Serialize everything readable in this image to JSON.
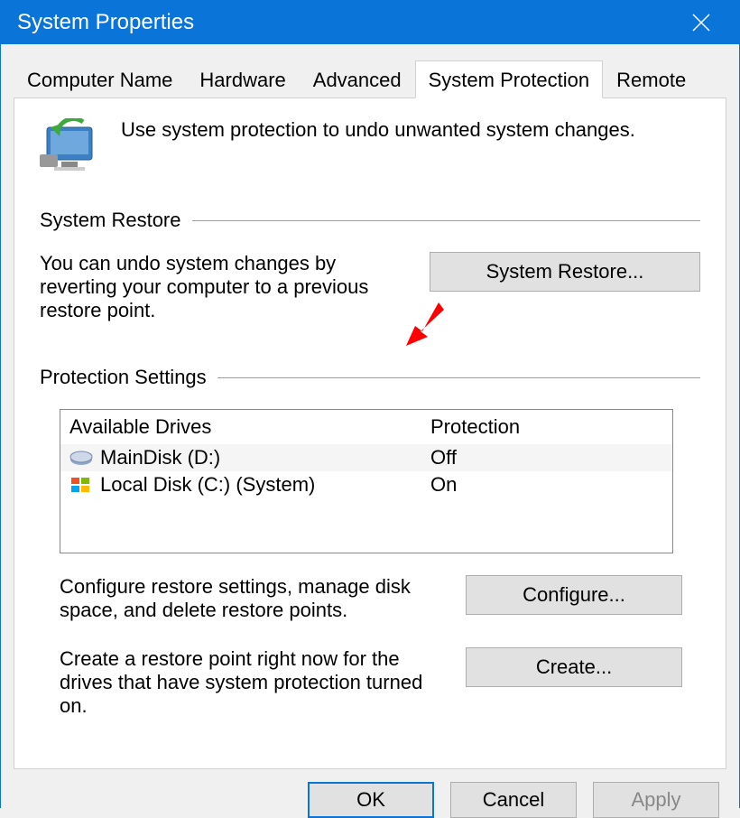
{
  "window": {
    "title": "System Properties"
  },
  "tabs": {
    "computer_name": "Computer Name",
    "hardware": "Hardware",
    "advanced": "Advanced",
    "system_protection": "System Protection",
    "remote": "Remote"
  },
  "header_text": "Use system protection to undo unwanted system changes.",
  "restore_section": {
    "title": "System Restore",
    "desc": "You can undo system changes by reverting your computer to a previous restore point.",
    "button": "System Restore..."
  },
  "protection_section": {
    "title": "Protection Settings",
    "columns": {
      "drives": "Available Drives",
      "protection": "Protection"
    },
    "rows": [
      {
        "name": "MainDisk (D:)",
        "protection": "Off",
        "icon": "hdd"
      },
      {
        "name": "Local Disk (C:) (System)",
        "protection": "On",
        "icon": "windows"
      }
    ],
    "configure_desc": "Configure restore settings, manage disk space, and delete restore points.",
    "configure_btn": "Configure...",
    "create_desc": "Create a restore point right now for the drives that have system protection turned on.",
    "create_btn": "Create..."
  },
  "buttons": {
    "ok": "OK",
    "cancel": "Cancel",
    "apply": "Apply"
  },
  "annotation": {
    "arrow_points_to": "System Restore button"
  }
}
